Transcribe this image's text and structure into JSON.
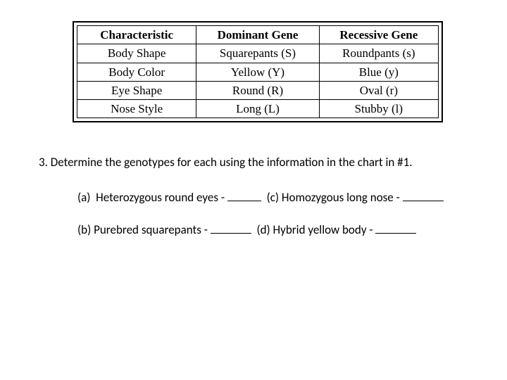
{
  "table": {
    "headers": [
      "Characteristic",
      "Dominant Gene",
      "Recessive Gene"
    ],
    "rows": [
      [
        "Body Shape",
        "Squarepants (S)",
        "Roundpants (s)"
      ],
      [
        "Body Color",
        "Yellow (Y)",
        "Blue (y)"
      ],
      [
        "Eye Shape",
        "Round (R)",
        "Oval (r)"
      ],
      [
        "Nose Style",
        "Long (L)",
        "Stubby (l)"
      ]
    ]
  },
  "question": {
    "number": "3.",
    "prompt": "Determine the genotypes for each using the information in the chart in #1.",
    "items": {
      "a_label": "(a)",
      "a_text": "Heterozygous round eyes -",
      "c_label": "(c)",
      "c_text": "Homozygous long nose -",
      "b_label": "(b)",
      "b_text": "Purebred squarepants -",
      "d_label": "(d)",
      "d_text": "Hybrid yellow body -"
    }
  }
}
